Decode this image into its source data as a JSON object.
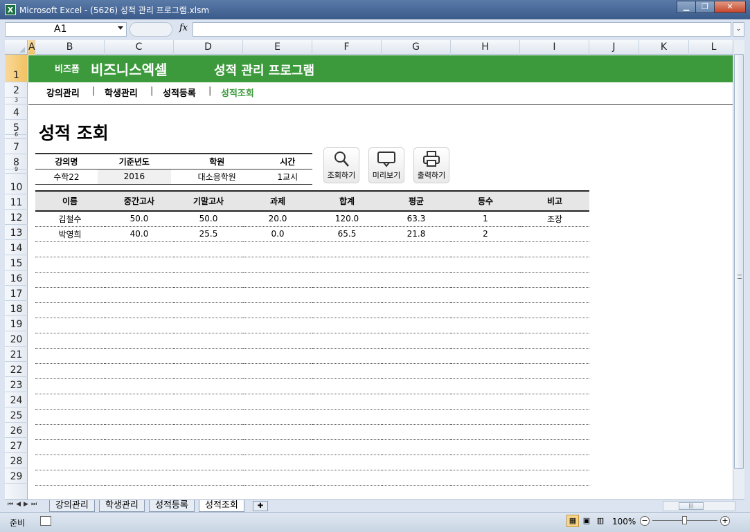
{
  "window": {
    "title": "Microsoft Excel - (5626) 성적 관리 프로그램.xlsm",
    "app_icon": "X",
    "minimize": "▁",
    "restore": "❐",
    "close": "✕"
  },
  "formula_bar": {
    "name_box": "A1",
    "fx": "fx",
    "value": ""
  },
  "columns": [
    "A",
    "B",
    "C",
    "D",
    "E",
    "F",
    "G",
    "H",
    "I",
    "J",
    "K",
    "L"
  ],
  "rows": [
    "1",
    "2",
    "3",
    "4",
    "5",
    "6",
    "7",
    "8",
    "9",
    "10",
    "11",
    "12",
    "13",
    "14",
    "15",
    "16",
    "17",
    "18",
    "19",
    "20",
    "21",
    "22",
    "23",
    "24",
    "25",
    "26",
    "27",
    "28",
    "29"
  ],
  "banner": {
    "brand_small": "비즈폼",
    "brand_big": "비즈니스엑셀",
    "app_title": "성적 관리 프로그램",
    "color": "#3c9a3c"
  },
  "nav": {
    "items": [
      {
        "label": "강의관리",
        "active": false
      },
      {
        "label": "학생관리",
        "active": false
      },
      {
        "label": "성적등록",
        "active": false
      },
      {
        "label": "성적조회",
        "active": true
      }
    ],
    "separator": "|"
  },
  "page_title": "성적 조회",
  "filter": {
    "headers": [
      "강의명",
      "기준년도",
      "학원",
      "시간"
    ],
    "values": [
      "수학22",
      "2016",
      "대소응학원",
      "1교시"
    ]
  },
  "actions": [
    {
      "label": "조회하기",
      "icon": "search-icon"
    },
    {
      "label": "미리보기",
      "icon": "monitor-icon"
    },
    {
      "label": "출력하기",
      "icon": "printer-icon"
    }
  ],
  "results": {
    "headers": [
      "이름",
      "중간고사",
      "기말고사",
      "과제",
      "합계",
      "평균",
      "등수",
      "비고"
    ],
    "rows": [
      [
        "김철수",
        "50.0",
        "50.0",
        "20.0",
        "120.0",
        "63.3",
        "1",
        "조장"
      ],
      [
        "박영희",
        "40.0",
        "25.5",
        "0.0",
        "65.5",
        "21.8",
        "2",
        ""
      ]
    ],
    "empty_rows": 17
  },
  "sheet_tabs": [
    {
      "label": "강의관리",
      "active": false
    },
    {
      "label": "학생관리",
      "active": false
    },
    {
      "label": "성적등록",
      "active": false
    },
    {
      "label": "성적조회",
      "active": true
    }
  ],
  "status": {
    "ready": "준비",
    "zoom": "100%"
  }
}
